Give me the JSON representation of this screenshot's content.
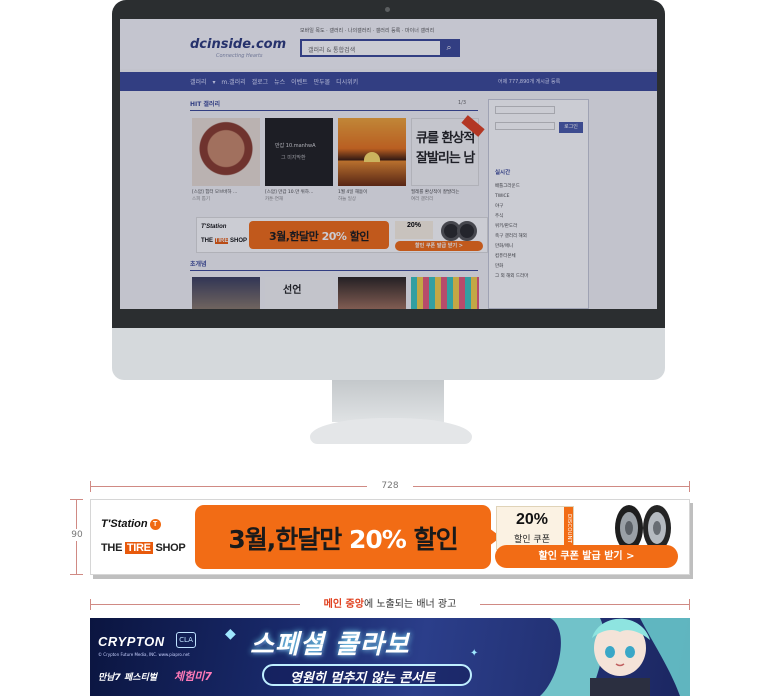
{
  "screen": {
    "logo": "dcinside.com",
    "logo_tagline": "Connecting Hearts",
    "top_links": "모바일 목도 · 갤러리 · 나의갤러리 · 갤러리 등록 · 마이너 갤러리",
    "search_placeholder": "갤러리 & 통합검색",
    "nav_items": [
      "갤러리 ▾",
      "m.갤러리",
      "갤로그",
      "뉴스",
      "이벤트",
      "만두몰",
      "디시위키"
    ],
    "nav_right": "어제 777,890개 게시글 등록",
    "section_title": "HIT 갤러리",
    "section_page": "1/3",
    "thumb_captions": [
      {
        "title": "[스압] 힘터 모브바하 …",
        "sub": "스피 톱기"
      },
      {
        "title": "[스압] 만갑 10.만 위하…",
        "sub": "카툰·연재"
      },
      {
        "title": "1월 4일 해돋이",
        "sub": "하늘 일상"
      },
      {
        "title": "필레를 환상적이 잘발리는",
        "sub": "여러 갤러리"
      }
    ],
    "thumb_overlay_text": "만갑 10.manhwA",
    "thumb_overlay_sub": "그 미지막환",
    "section2_title": "초개념",
    "side_button": "로그인",
    "side_head": "실시간",
    "side_list": [
      "배틀그라운드",
      "TWICE",
      "야구",
      "주식",
      "위키/판도라",
      "축구 갤러리 해외",
      "만화/애니",
      "컴퓨터본체",
      "만화",
      "그 외 해외 드라마"
    ]
  },
  "banner": {
    "dim_width": "728",
    "dim_height": "90",
    "brand_top": "T'Station",
    "brand_bottom_pre": "THE ",
    "brand_bottom_tire": "TIRE",
    "brand_bottom_post": " SHOP",
    "headline_pre": "3월,한달만 ",
    "headline_pct": "20%",
    "headline_post": " 할인",
    "coupon_pct": "20%",
    "coupon_label": "할인 쿠폰",
    "coupon_strip": "DISCOUNT",
    "cta": "할인 쿠폰 발급 받기  >"
  },
  "caption": {
    "highlight": "메인 중앙",
    "rest": "에 노출되는 배너 광고"
  },
  "crypton": {
    "logo": "CRYPTON",
    "badge": "CLA",
    "copyright": "© Crypton Future Media, INC. www.piapro.net",
    "sub1": "만남7 페스티벌",
    "sub2": "체험미7",
    "title": "스페셜 콜라보",
    "pill": "영원히 멈추지 않는 콘서트"
  },
  "colors": {
    "brand_orange": "#f26c15",
    "dc_blue": "#3b4998",
    "annotation": "#d08a84",
    "highlight_red": "#e0401f"
  }
}
